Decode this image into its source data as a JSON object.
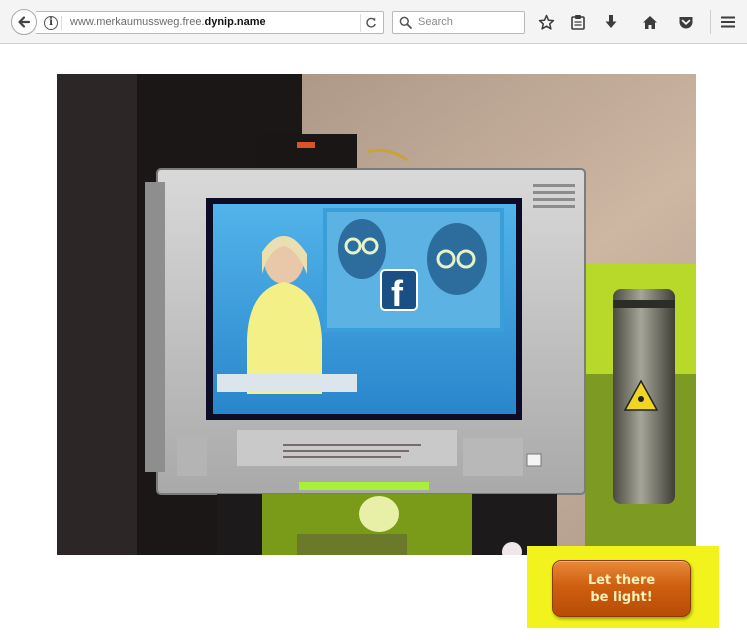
{
  "browser": {
    "url_prefix": "www.merkaumussweg.free.",
    "url_domain": "dynip.name",
    "search_placeholder": "Search",
    "icons": [
      "back-icon",
      "info-icon",
      "reload-icon",
      "search-icon",
      "bookmark-star-icon",
      "reading-list-icon",
      "download-icon",
      "home-icon",
      "pocket-icon",
      "menu-icon"
    ]
  },
  "page": {
    "light_button_label": "Let there be light!"
  },
  "colors": {
    "panel_yellow": "#f2f21c",
    "button_orange": "#cf5f10",
    "button_text": "#f8f0b8",
    "tv_screen_blue": "#2f9ad8"
  }
}
